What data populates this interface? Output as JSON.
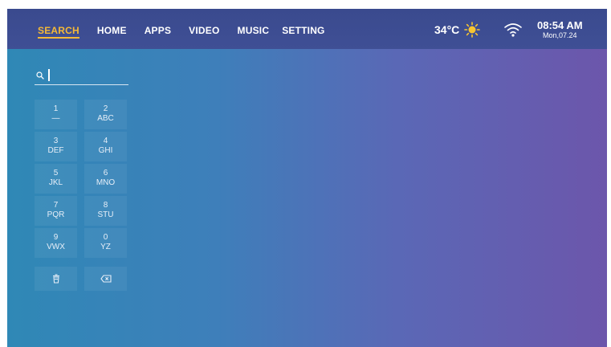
{
  "nav": {
    "items": [
      {
        "label": "SEARCH",
        "active": true
      },
      {
        "label": "HOME",
        "active": false
      },
      {
        "label": "APPS",
        "active": false
      },
      {
        "label": "VIDEO",
        "active": false
      },
      {
        "label": "MUSIC",
        "active": false
      },
      {
        "label": "SETTING",
        "active": false
      }
    ]
  },
  "status": {
    "temperature": "34°C",
    "weather_icon": "sun-icon",
    "wifi_icon": "wifi-icon",
    "time": "08:54 AM",
    "date": "Mon,07.24"
  },
  "search": {
    "icon": "search-icon",
    "value": ""
  },
  "keypad": {
    "keys": [
      {
        "num": "1",
        "letters": "—"
      },
      {
        "num": "2",
        "letters": "ABC"
      },
      {
        "num": "3",
        "letters": "DEF"
      },
      {
        "num": "4",
        "letters": "GHI"
      },
      {
        "num": "5",
        "letters": "JKL"
      },
      {
        "num": "6",
        "letters": "MNO"
      },
      {
        "num": "7",
        "letters": "PQR"
      },
      {
        "num": "8",
        "letters": "STU"
      },
      {
        "num": "9",
        "letters": "VWX"
      },
      {
        "num": "0",
        "letters": "YZ"
      }
    ],
    "clear_icon": "trash-icon",
    "backspace_icon": "backspace-icon"
  },
  "colors": {
    "accent": "#f5b936",
    "topbar": "#3d4c92",
    "bg_left": "#2f88b6",
    "bg_right": "#6c56ab"
  }
}
